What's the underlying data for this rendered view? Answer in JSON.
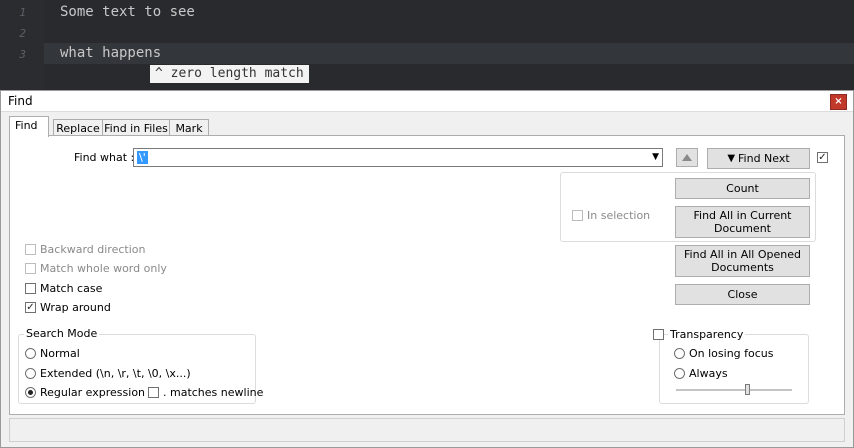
{
  "editor": {
    "lines": [
      {
        "num": "1",
        "text": "Some text to see"
      },
      {
        "num": "2",
        "text": ""
      },
      {
        "num": "3",
        "text": "what happens"
      }
    ],
    "tooltip": "^ zero length match"
  },
  "dialog": {
    "title": "Find",
    "close_glyph": "×",
    "tabs": [
      "Find",
      "Replace",
      "Find in Files",
      "Mark"
    ],
    "find_what_label": "Find what :",
    "find_what_value": "\\'",
    "up_arrow_glyph": "▲",
    "buttons": {
      "find_next": "Find Next",
      "count": "Count",
      "find_all_current": "Find All in Current Document",
      "find_all_opened": "Find All in All Opened Documents",
      "close": "Close"
    },
    "in_selection": "In selection",
    "options": {
      "backward": "Backward direction",
      "whole_word": "Match whole word only",
      "match_case": "Match case",
      "wrap_around": "Wrap around"
    },
    "search_mode": {
      "title": "Search Mode",
      "normal": "Normal",
      "extended": "Extended (\\n, \\r, \\t, \\0, \\x...)",
      "regex": "Regular expression",
      "matches_newline": ". matches newline",
      "selected": "regex"
    },
    "transparency": {
      "title": "Transparency",
      "on_losing_focus": "On losing focus",
      "always": "Always",
      "level": 0.62
    },
    "checks": {
      "find_next_option": true,
      "in_selection": false,
      "backward": false,
      "whole_word": false,
      "match_case": false,
      "wrap_around": true,
      "matches_newline": false,
      "transparency": false
    },
    "check_glyph": "✓",
    "dropdown_glyph": "▼"
  }
}
